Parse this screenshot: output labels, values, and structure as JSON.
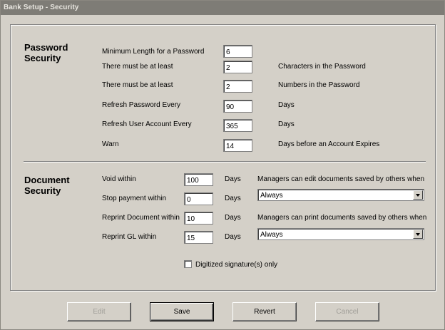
{
  "window": {
    "title": "Bank Setup - Security"
  },
  "password_security": {
    "heading": "Password Security",
    "rows": [
      {
        "label": "Minimum Length for a Password",
        "value": "6",
        "suffix": ""
      },
      {
        "label": "There must be at least",
        "value": "2",
        "suffix": "Characters in the Password"
      },
      {
        "label": "There must be at least",
        "value": "2",
        "suffix": "Numbers in the Password"
      },
      {
        "label": "Refresh Password Every",
        "value": "90",
        "suffix": "Days"
      },
      {
        "label": "Refresh User Account Every",
        "value": "365",
        "suffix": "Days"
      },
      {
        "label": "Warn",
        "value": "14",
        "suffix": "Days before an Account Expires"
      }
    ]
  },
  "document_security": {
    "heading": "Document Security",
    "rows": [
      {
        "label": "Void within",
        "value": "100",
        "unit": "Days"
      },
      {
        "label": "Stop payment within",
        "value": "0",
        "unit": "Days"
      },
      {
        "label": "Reprint Document within",
        "value": "10",
        "unit": "Days"
      },
      {
        "label": "Reprint GL within",
        "value": "15",
        "unit": "Days"
      }
    ],
    "edit_note": "Managers can edit documents saved by others when",
    "edit_select": "Always",
    "print_note": "Managers can print documents saved by others when",
    "print_select": "Always",
    "digitized_label": "Digitized signature(s) only"
  },
  "buttons": {
    "edit": "Edit",
    "save": "Save",
    "revert": "Revert",
    "cancel": "Cancel"
  }
}
